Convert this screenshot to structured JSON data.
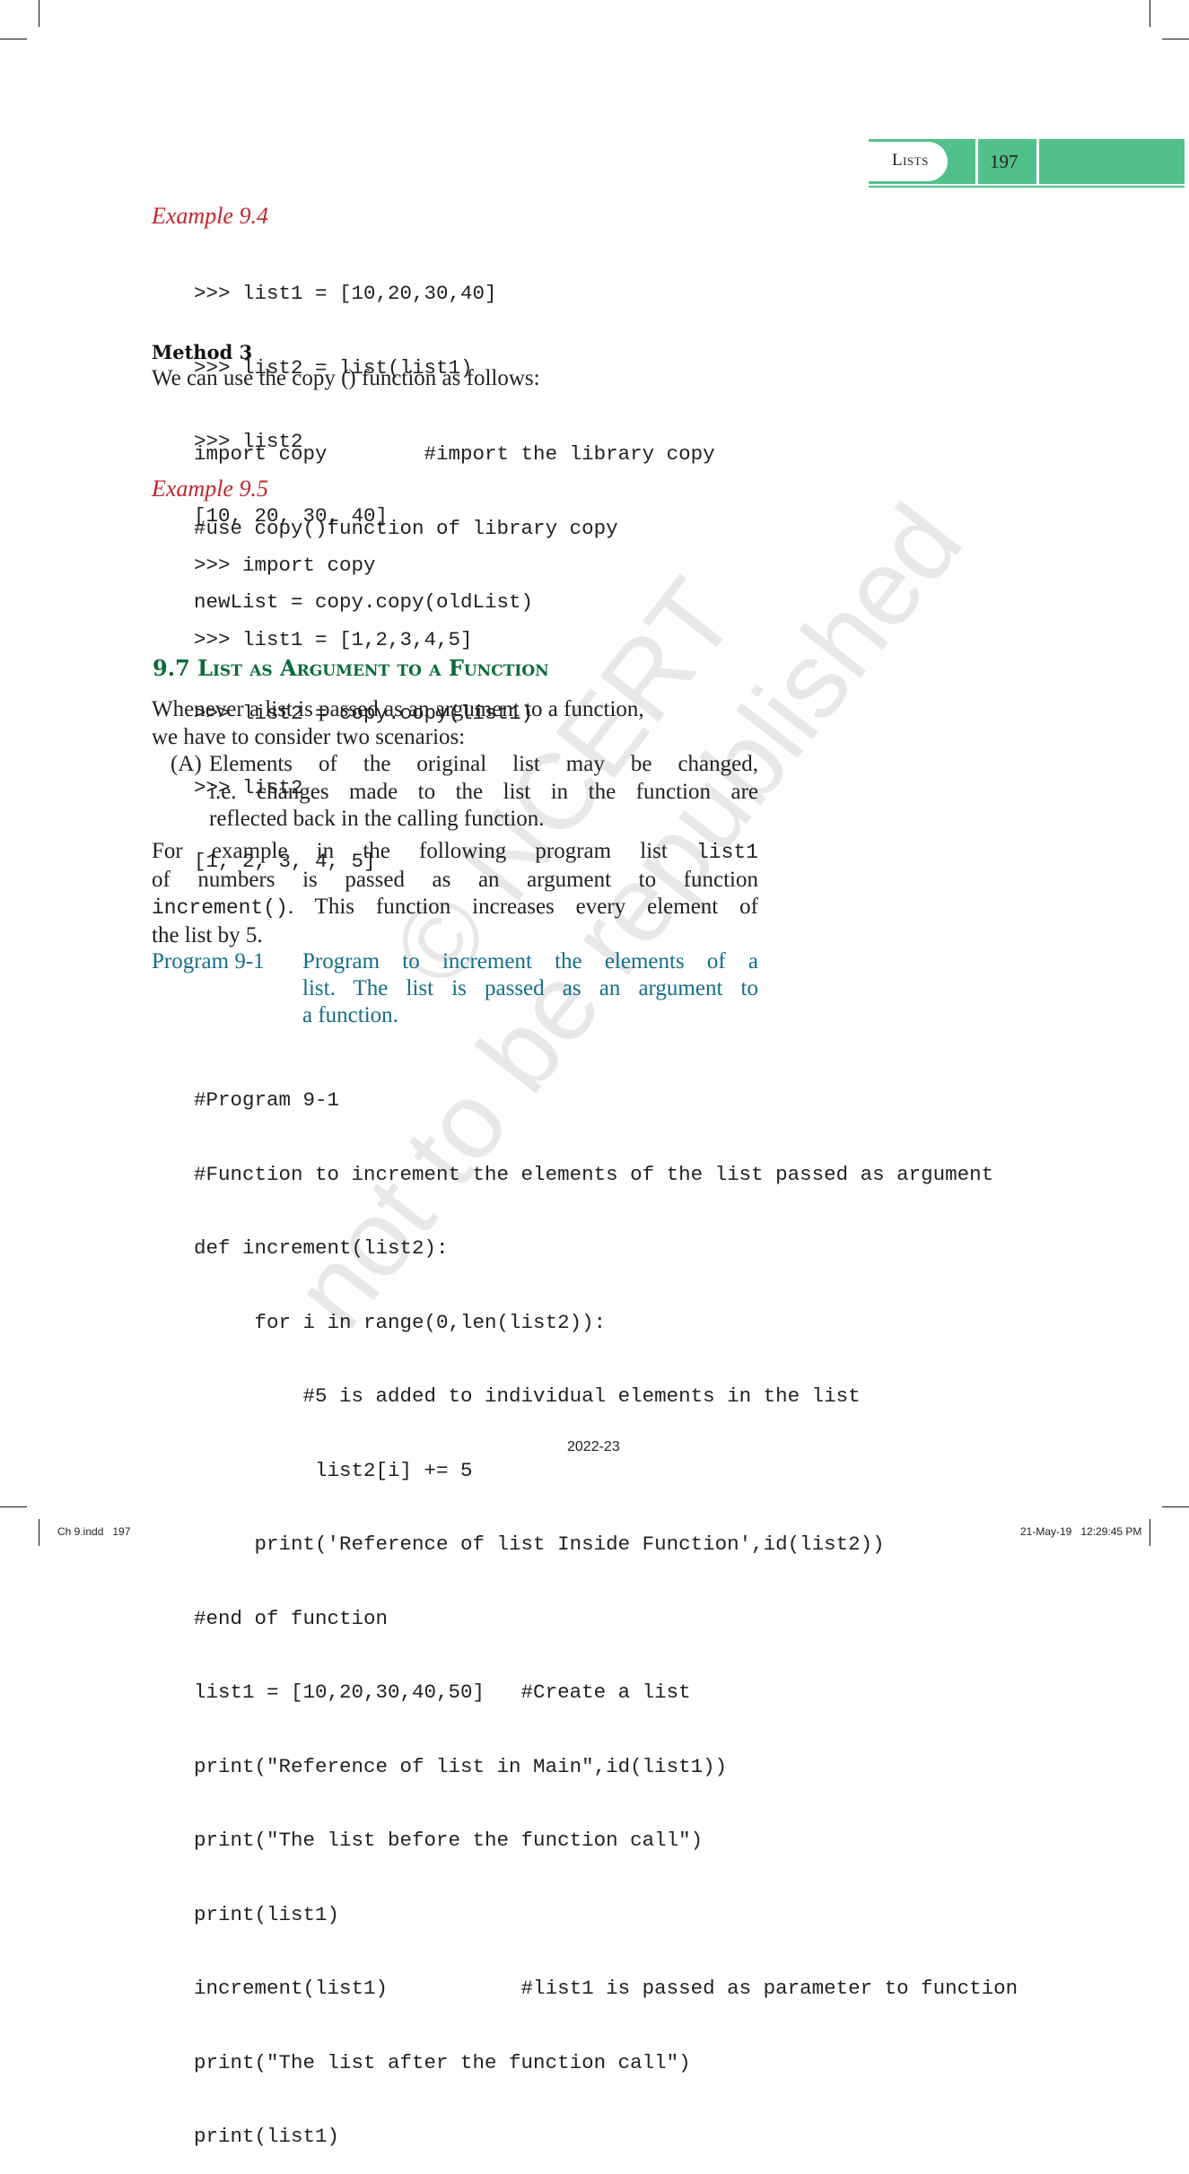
{
  "header": {
    "chapter_title": "Lists",
    "page_number": "197",
    "accent_color": "#52c08a"
  },
  "example_9_4": {
    "title": "Example 9.4",
    "code": [
      ">>> list1 = [10,20,30,40]",
      ">>> list2 = list(list1)",
      ">>> list2",
      "[10, 20, 30, 40]"
    ]
  },
  "method_3": {
    "title": "Method 3",
    "intro": "We can use the copy () function as follows:",
    "code": [
      "import copy        #import the library copy",
      "#use copy()function of library copy",
      "newList = copy.copy(oldList)"
    ]
  },
  "example_9_5": {
    "title": "Example 9.5",
    "code": [
      ">>> import copy",
      ">>> list1 = [1,2,3,4,5]",
      ">>> list2 = copy.copy(list1)",
      ">>> list2",
      "[1, 2, 3, 4, 5]"
    ]
  },
  "section_9_7": {
    "heading": "9.7 List as Argument to a Function",
    "intro_line1": "Whenever a list is passed as an argument to a function,",
    "intro_line2": "we have to consider two scenarios:",
    "scenario_a_marker": "(A)",
    "scenario_a_line1": "Elements of the original list may be changed,",
    "scenario_a_line2": "i.e. changes made to the list in the function are",
    "scenario_a_line3": "reflected back in the calling function.",
    "para_line1_text": "For example in the following program list",
    "para_line1_code": "list1",
    "para_line2": "of numbers is passed as an argument to function",
    "para_line3_code": "increment()",
    "para_line3_text": ". This function increases every element of",
    "para_line4": "the list by 5."
  },
  "program_9_1": {
    "label": "Program 9-1",
    "caption_line1": "Program to increment the elements of a",
    "caption_line2": "list. The list is passed as an argument to",
    "caption_line3": "a function.",
    "code": [
      "#Program 9-1",
      "#Function to increment the elements of the list passed as argument",
      "def increment(list2):",
      "     for i in range(0,len(list2)):",
      "         #5 is added to individual elements in the list",
      "          list2[i] += 5",
      "     print('Reference of list Inside Function',id(list2))",
      "#end of function",
      "list1 = [10,20,30,40,50]   #Create a list",
      "print(\"Reference of list in Main\",id(list1))",
      "print(\"The list before the function call\")",
      "print(list1)",
      "increment(list1)           #list1 is passed as parameter to function",
      "print(\"The list after the function call\")",
      "print(list1)"
    ]
  },
  "watermark": {
    "line1": "© NCERT",
    "line2": "not to be republished"
  },
  "footer": {
    "year": "2022-23",
    "slug_left": "Ch 9.indd   197",
    "slug_right": "21-May-19   12:29:45 PM"
  }
}
